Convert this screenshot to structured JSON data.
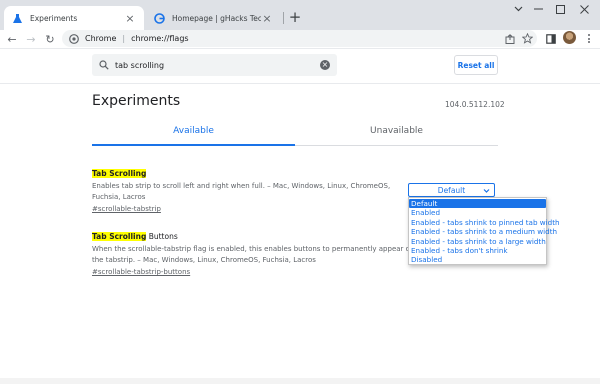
{
  "tabs": [
    {
      "title": "Experiments",
      "close": "×"
    },
    {
      "title": "Homepage | gHacks Technology N",
      "close": "×"
    }
  ],
  "newtab": "+",
  "window": {
    "minimize": "–",
    "maximize": "□",
    "close": "✕"
  },
  "toolbar": {
    "back": "←",
    "forward": "→",
    "reload": "↻",
    "omnibox_label": "Chrome",
    "omnibox_sep": "|",
    "url": "chrome://flags"
  },
  "search": {
    "value": "tab scrolling",
    "clear": "×"
  },
  "reset_label": "Reset all",
  "page": {
    "title": "Experiments",
    "version": "104.0.5112.102"
  },
  "page_tabs": {
    "available": "Available",
    "unavailable": "Unavailable"
  },
  "experiments": [
    {
      "name_highlight": "Tab Scrolling",
      "name_rest": "",
      "desc_line1": "Enables tab strip to scroll left and right when full. – Mac, Windows, Linux, ChromeOS,",
      "desc_line2": "Fuchsia, Lacros",
      "link": "#scrollable-tabstrip",
      "select_value": "Default"
    },
    {
      "name_highlight": "Tab Scrolling",
      "name_rest": " Buttons",
      "desc_line1": "When the scrollable-tabstrip flag is enabled, this enables buttons to permanently appear on",
      "desc_line2": "the tabstrip. – Mac, Windows, Linux, ChromeOS, Fuchsia, Lacros",
      "link": "#scrollable-tabstrip-buttons"
    }
  ],
  "dropdown_options": [
    "Default",
    "Enabled",
    "Enabled - tabs shrink to pinned tab width",
    "Enabled - tabs shrink to a medium width",
    "Enabled - tabs shrink to a large width",
    "Enabled - tabs don't shrink",
    "Disabled"
  ],
  "colors": {
    "accent": "#1a73e8",
    "highlight": "#ffff00",
    "tabstrip": "#dee1e6"
  }
}
